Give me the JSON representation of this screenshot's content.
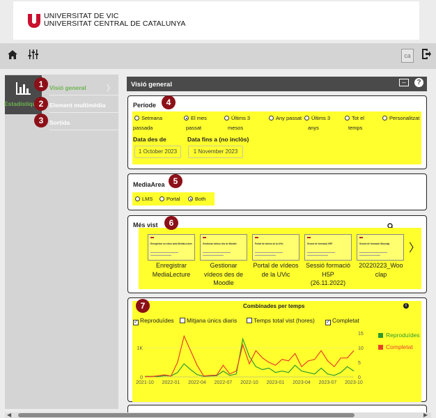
{
  "header": {
    "logo_line1": "UNIVERSITAT DE VIC",
    "logo_line2": "UNIVERSITAT CENTRAL DE CATALUNYA",
    "brand_color": "#c8102e",
    "lang": "ca"
  },
  "toolbar": {
    "home_icon": "home-icon",
    "settings_icon": "sliders-icon",
    "exit_icon": "exit-icon"
  },
  "sidebar": {
    "section_label": "Estadístiques",
    "items": [
      {
        "label": "Visió general",
        "active": true
      },
      {
        "label": "Element multimèdia",
        "active": false
      },
      {
        "label": "Sortida",
        "active": false
      }
    ]
  },
  "badges": [
    "1",
    "2",
    "3",
    "4",
    "5",
    "6",
    "7"
  ],
  "main": {
    "title": "Visió general",
    "period": {
      "title": "Període",
      "options": [
        {
          "line1": "Setmana",
          "line2": "passada",
          "selected": false
        },
        {
          "line1": "El mes",
          "line2": "passat",
          "selected": true
        },
        {
          "line1": "Últims 3",
          "line2": "mesos",
          "selected": false
        },
        {
          "line1": "Any passat",
          "line2": "",
          "selected": false
        },
        {
          "line1": "Últims 3",
          "line2": "anys",
          "selected": false
        },
        {
          "line1": "Tot el",
          "line2": "temps",
          "selected": false
        },
        {
          "line1": "Personalitzat",
          "line2": "",
          "selected": false
        }
      ],
      "from_label": "Data des de",
      "to_label": "Data fins a (no inclòs)",
      "from_value": "1 October 2023",
      "to_value": "1 November 2023"
    },
    "media_area": {
      "title": "MediaArea",
      "options": [
        {
          "label": "LMS",
          "selected": false
        },
        {
          "label": "Portal",
          "selected": false
        },
        {
          "label": "Both",
          "selected": true
        }
      ]
    },
    "most_viewed": {
      "title": "Més vist",
      "items": [
        {
          "line1": "Enregistrar",
          "line2": "MediaLecture",
          "line3": "",
          "line4": "",
          "thumb": "Enregistrar un vídeo amb MediaLecture"
        },
        {
          "line1": "Gestionar",
          "line2": "vídeos des de",
          "line3": "Moodle",
          "line4": "",
          "thumb": "Gestionar vídeos des de Moodle"
        },
        {
          "line1": "Portal de vídeos",
          "line2": "de la UVic",
          "line3": "",
          "line4": "",
          "thumb": "Portal de vídeos de la UVic"
        },
        {
          "line1": "Sessió formació",
          "line2": "H5P",
          "line3": "(26.11.2022)",
          "line4": "",
          "thumb": "Sessió de formació H5P"
        },
        {
          "line1": "20220223_Woo",
          "line2": "clap",
          "line3": "",
          "line4": "",
          "thumb": "Sessió de formació Wooclap"
        }
      ]
    },
    "chart": {
      "title": "Combinades per temps",
      "checkboxes": [
        {
          "label": "Reproduïdes",
          "checked": true
        },
        {
          "label": "Mitjana únics diaris",
          "checked": false
        },
        {
          "label": "Temps total vist (hores)",
          "checked": false
        },
        {
          "label": "Completat",
          "checked": true
        }
      ],
      "legend": [
        {
          "label": "Reproduïdes",
          "color": "#2e9a2e"
        },
        {
          "label": "Completat",
          "color": "#e8402a"
        }
      ]
    }
  },
  "chart_data": {
    "type": "line",
    "title": "Combinades per temps",
    "x_ticks": [
      "2021-10",
      "2022-01",
      "2022-04",
      "2022-07",
      "2022-10",
      "2023-01",
      "2023-04",
      "2023-07",
      "2023-10"
    ],
    "y_left_ticks": [
      "0",
      "1K"
    ],
    "y_right_ticks": [
      "0",
      "5",
      "10",
      "15"
    ],
    "ylim_left": [
      0,
      1600
    ],
    "ylim_right": [
      0,
      16
    ],
    "series": [
      {
        "name": "Reproduïdes",
        "color": "#2e9a2e",
        "values": [
          0.2,
          0.2,
          0.1,
          0.4,
          0.3,
          1.5,
          4.5,
          2.5,
          0.8,
          0.2,
          0.3,
          0.4,
          2.0,
          0.5,
          1.0,
          13.0,
          7.0,
          3.5,
          2.5,
          3.0,
          1.5,
          2.0,
          1.5,
          4.0,
          2.0,
          1.5,
          1.0,
          3.0,
          1.0,
          0.5,
          1.5,
          3.5,
          2.0
        ]
      },
      {
        "name": "Completat",
        "color": "#e8402a",
        "values": [
          0.1,
          0.1,
          0.4,
          0.7,
          0.3,
          5.0,
          14.0,
          9.0,
          4.0,
          0.3,
          0.5,
          0.6,
          4.0,
          1.0,
          2.0,
          11.0,
          4.5,
          9.0,
          6.5,
          5.0,
          4.0,
          6.0,
          5.5,
          8.0,
          3.5,
          5.5,
          6.0,
          9.0,
          5.5,
          3.5,
          6.5,
          6.5,
          9.0
        ]
      }
    ]
  }
}
